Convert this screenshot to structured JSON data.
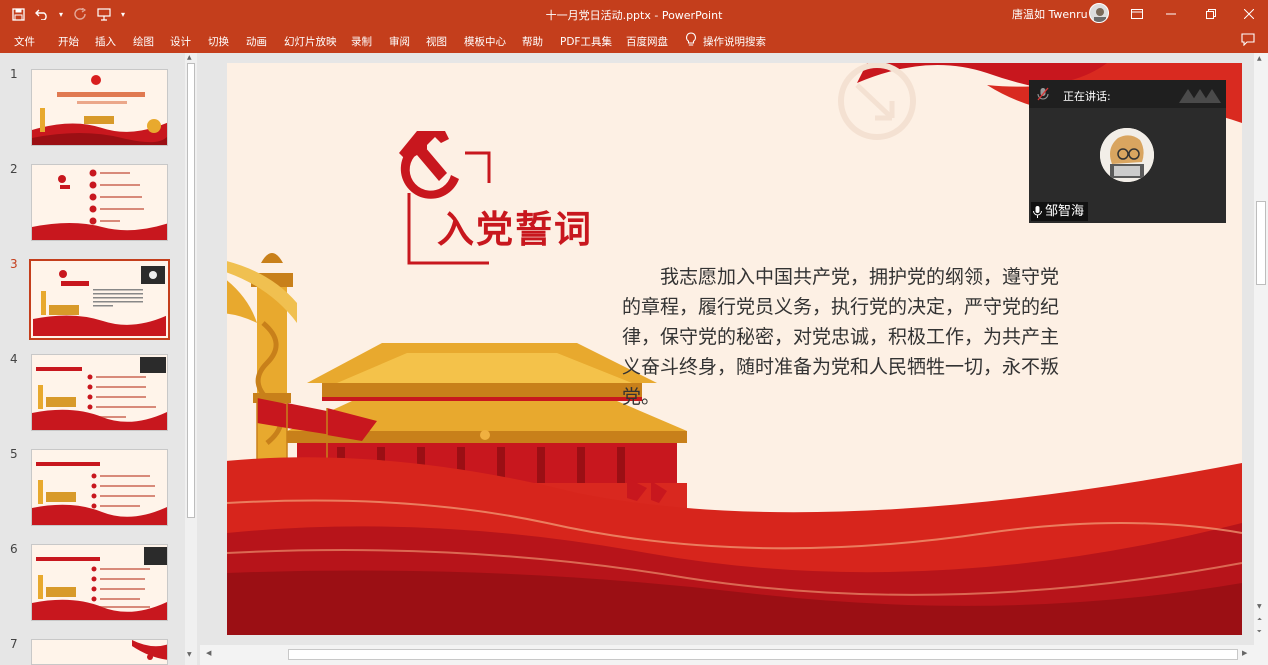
{
  "app": {
    "title": "十一月党日活动.pptx  -  PowerPoint",
    "user_name": "唐温如 Twenru"
  },
  "ribbon": {
    "tabs": [
      "文件",
      "开始",
      "插入",
      "绘图",
      "设计",
      "切换",
      "动画",
      "幻灯片放映",
      "录制",
      "审阅",
      "视图",
      "模板中心",
      "帮助",
      "PDF工具集",
      "百度网盘"
    ],
    "tell_me": "操作说明搜索"
  },
  "thumbnails": {
    "numbers": [
      "1",
      "2",
      "3",
      "4",
      "5",
      "6",
      "7"
    ],
    "active_index": 3
  },
  "slide": {
    "title": "入党誓词",
    "oath": "我志愿加入中国共产党，拥护党的纲领，遵守党的章程，履行党员义务，执行党的决定，严守党的纪律，保守党的秘密，对党忠诚，积极工作，为共产主义奋斗终身，随时准备为党和人民牺牲一切，永不叛党。"
  },
  "speaker_panel": {
    "label": "正在讲话:",
    "name": "邹智海"
  },
  "colors": {
    "accent": "#c43e1c",
    "slide_red": "#c8171e",
    "slide_bg": "#fdf0e4"
  }
}
